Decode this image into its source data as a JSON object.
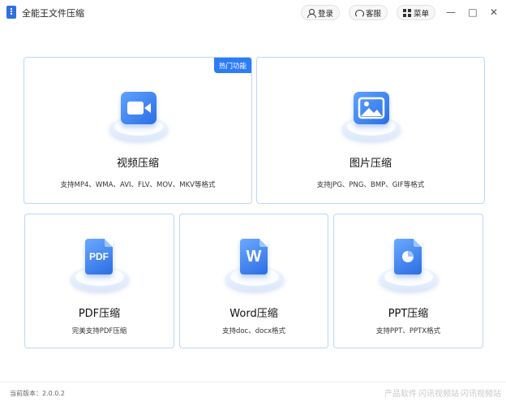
{
  "app": {
    "title": "全能王文件压缩"
  },
  "header": {
    "login_label": "登录",
    "service_label": "客服",
    "menu_label": "菜单"
  },
  "window_controls": {
    "minimize": "—",
    "maximize": "□",
    "close": "✕"
  },
  "cards": {
    "video": {
      "badge": "热门功能",
      "title": "视频压缩",
      "desc": "支持MP4、WMA、AVI、FLV、MOV、MKV等格式",
      "icon": "video-camera-icon"
    },
    "image": {
      "title": "图片压缩",
      "desc": "支持JPG、PNG、BMP、GIF等格式",
      "icon": "image-icon"
    },
    "pdf": {
      "title": "PDF压缩",
      "desc": "完美支持PDF压缩",
      "icon_text": "PDF",
      "icon": "pdf-file-icon"
    },
    "word": {
      "title": "Word压缩",
      "desc": "支持doc、docx格式",
      "icon_text": "W",
      "icon": "word-file-icon"
    },
    "ppt": {
      "title": "PPT压缩",
      "desc": "支持PPT、PPTX格式",
      "icon": "ppt-file-icon"
    }
  },
  "footer": {
    "version": "当前版本：2.0.0.2"
  },
  "watermark": {
    "left": "产品软件",
    "mid": "闪讯视频站",
    "right": "闪讯视频站"
  },
  "colors": {
    "accent": "#2d7cf6",
    "card_border": "#bcd6f6",
    "badge": "#2d7cf6"
  }
}
